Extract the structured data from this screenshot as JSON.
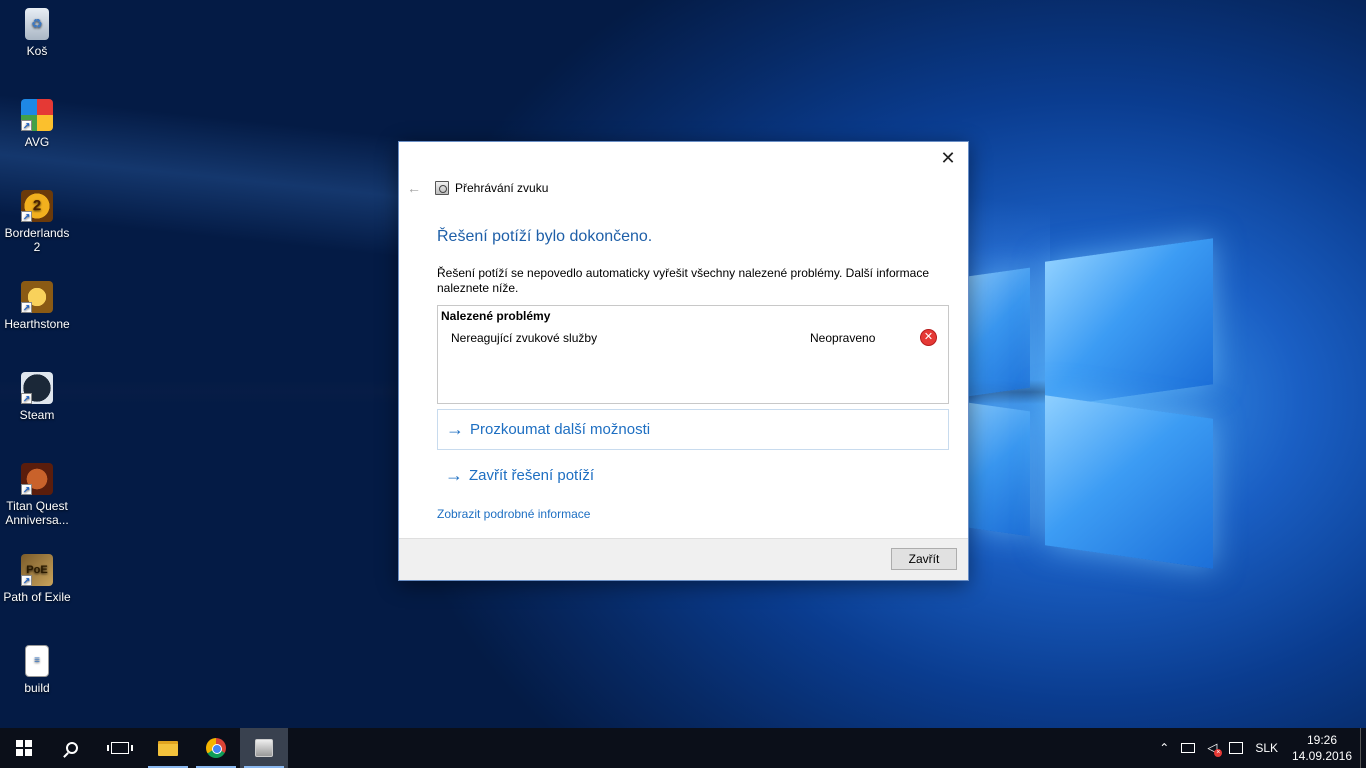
{
  "desktop": {
    "icons": [
      {
        "label": "Koš",
        "glyph": "♻"
      },
      {
        "label": "AVG",
        "glyph": ""
      },
      {
        "label": "Borderlands 2",
        "glyph": "2"
      },
      {
        "label": "Hearthstone",
        "glyph": ""
      },
      {
        "label": "Steam",
        "glyph": ""
      },
      {
        "label": "Titan Quest Anniversa...",
        "glyph": ""
      },
      {
        "label": "Path of Exile",
        "glyph": "PoE"
      },
      {
        "label": "build",
        "glyph": "≡"
      }
    ]
  },
  "dialog": {
    "close_glyph": "✕",
    "back_glyph": "←",
    "nav_title": "Přehrávání zvuku",
    "heading": "Řešení potíží bylo dokončeno.",
    "description": "Řešení potíží se nepovedlo automaticky vyřešit všechny nalezené problémy. Další informace naleznete níže.",
    "issues_header": "Nalezené problémy",
    "issues": [
      {
        "name": "Nereagující zvukové služby",
        "status": "Neopraveno",
        "icon": "error-icon",
        "icon_glyph": "✕"
      }
    ],
    "link_explore": "Prozkoumat další možnosti",
    "link_close_troubleshooter": "Zavřít řešení potíží",
    "link_arrow": "→",
    "details_link": "Zobrazit podrobné informace",
    "close_button": "Zavřít"
  },
  "taskbar": {
    "tray": {
      "chevron": "⌃",
      "volume_glyph": "◁",
      "mute_glyph": "×",
      "language": "SLK",
      "time": "19:26",
      "date": "14.09.2016"
    }
  },
  "colors": {
    "accent_blue": "#1e6fc2",
    "heading_blue": "#1e5fa8",
    "error_red": "#e53935",
    "taskbar_bg": "#0b0f19"
  }
}
